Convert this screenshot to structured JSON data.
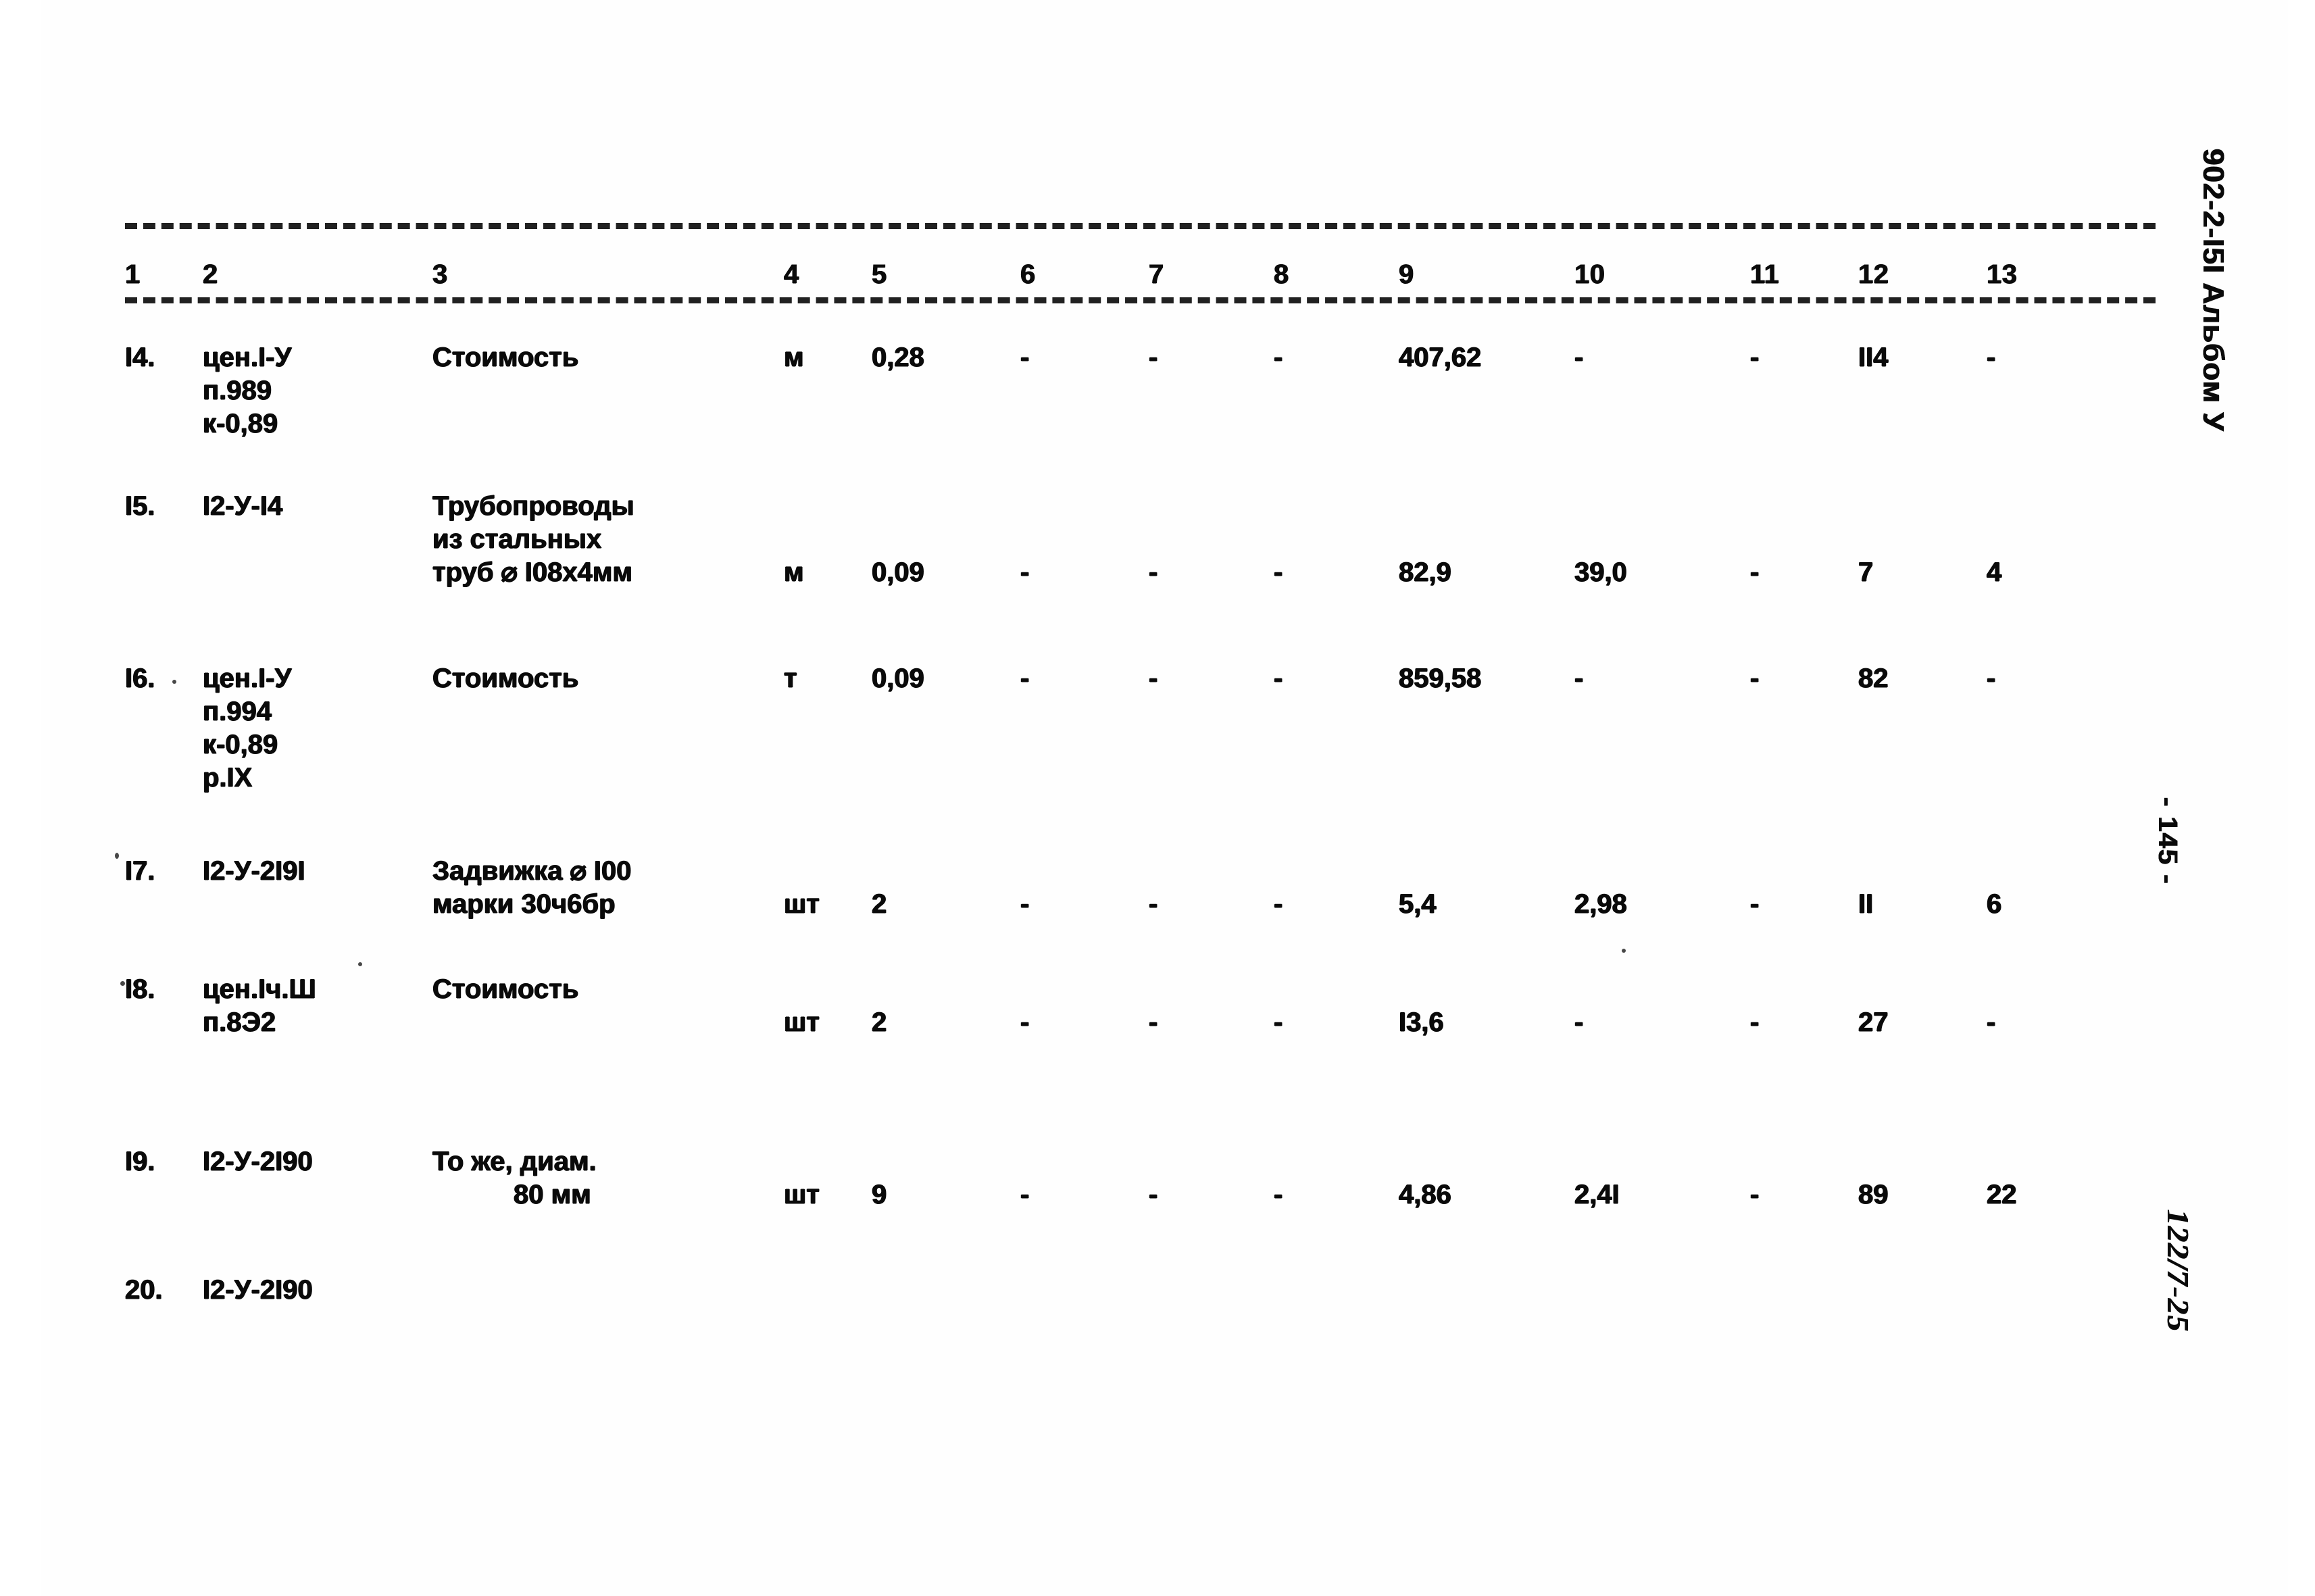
{
  "document": {
    "album_mark": "902-2-I5I Альбом У",
    "page_mark": "- 145 -",
    "stamp_mark": "122/7-25"
  },
  "table": {
    "column_numbers": [
      "1",
      "2",
      "3",
      "4",
      "5",
      "6",
      "7",
      "8",
      "9",
      "10",
      "11",
      "12",
      "13"
    ],
    "dash": "-",
    "rows": [
      {
        "num": "I4.",
        "code": [
          "цен.I-У",
          "п.989",
          "к-0,89"
        ],
        "desc": [
          "Стоимость"
        ],
        "unit": "м",
        "c5": "0,28",
        "c6": "-",
        "c7": "-",
        "c8": "-",
        "c9": "407,62",
        "c10": "-",
        "c11": "-",
        "c12": "II4",
        "c13": "-"
      },
      {
        "num": "I5.",
        "code": [
          "I2-У-I4"
        ],
        "desc": [
          "Трубопроводы",
          "из стальных",
          "труб ⌀ I08х4мм"
        ],
        "unit": "м",
        "c5": "0,09",
        "c6": "-",
        "c7": "-",
        "c8": "-",
        "c9": "82,9",
        "c10": "39,0",
        "c11": "-",
        "c12": "7",
        "c13": "4"
      },
      {
        "num": "I6.",
        "code": [
          "цен.I-У",
          "п.994",
          "к-0,89",
          "р.IХ"
        ],
        "desc": [
          "Стоимость"
        ],
        "unit": "т",
        "c5": "0,09",
        "c6": "-",
        "c7": "-",
        "c8": "-",
        "c9": "859,58",
        "c10": "-",
        "c11": "-",
        "c12": "82",
        "c13": "-"
      },
      {
        "num": "I7.",
        "code": [
          "I2-У-2I9I"
        ],
        "desc": [
          "Задвижка ⌀ I00",
          "марки 30ч6бр"
        ],
        "unit": "шт",
        "c5": "2",
        "c6": "-",
        "c7": "-",
        "c8": "-",
        "c9": "5,4",
        "c10": "2,98",
        "c11": "-",
        "c12": "II",
        "c13": "6"
      },
      {
        "num": "I8.",
        "code": [
          "цен.Iч.Ш",
          "п.8Э2"
        ],
        "desc": [
          "Стоимость"
        ],
        "unit": "шт",
        "c5": "2",
        "c6": "-",
        "c7": "-",
        "c8": "-",
        "c9": "I3,6",
        "c10": "-",
        "c11": "-",
        "c12": "27",
        "c13": "-"
      },
      {
        "num": "I9.",
        "code": [
          "I2-У-2I90"
        ],
        "desc": [
          "То же, диам.",
          "80 мм"
        ],
        "unit": "шт",
        "c5": "9",
        "c6": "-",
        "c7": "-",
        "c8": "-",
        "c9": "4,86",
        "c10": "2,4I",
        "c11": "-",
        "c12": "89",
        "c13": "22"
      },
      {
        "num": "20.",
        "code": [
          "I2-У-2I90"
        ],
        "desc": [],
        "unit": "",
        "c5": "",
        "c6": "",
        "c7": "",
        "c8": "",
        "c9": "",
        "c10": "",
        "c11": "",
        "c12": "",
        "c13": ""
      }
    ]
  }
}
